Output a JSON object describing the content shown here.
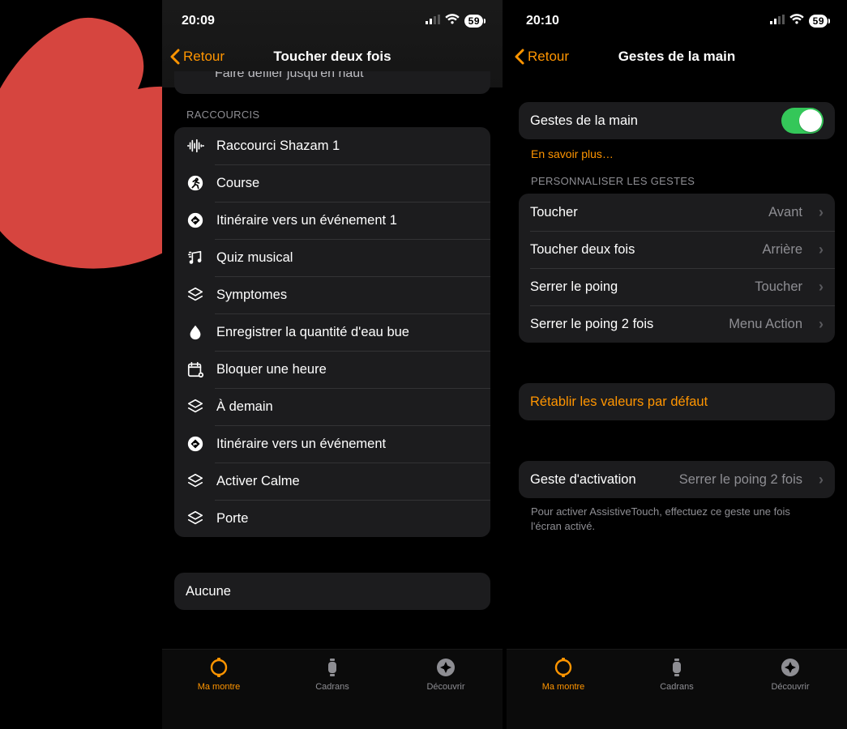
{
  "left": {
    "status": {
      "time": "20:09",
      "battery": "59"
    },
    "nav": {
      "back": "Retour",
      "title": "Toucher deux fois"
    },
    "peek_row": "Faire défiler jusqu'en haut",
    "section_header": "RACCOURCIS",
    "shortcuts": [
      {
        "icon": "waveform-icon",
        "label": "Raccourci Shazam 1"
      },
      {
        "icon": "running-icon",
        "label": "Course"
      },
      {
        "icon": "route-icon",
        "label": "Itinéraire vers un événement 1"
      },
      {
        "icon": "music-note-icon",
        "label": "Quiz musical"
      },
      {
        "icon": "layers-icon",
        "label": "Symptomes"
      },
      {
        "icon": "water-drop-icon",
        "label": "Enregistrer la quantité d'eau bue"
      },
      {
        "icon": "calendar-icon",
        "label": "Bloquer une heure"
      },
      {
        "icon": "layers-icon",
        "label": "À demain"
      },
      {
        "icon": "route-icon",
        "label": "Itinéraire vers un événement"
      },
      {
        "icon": "layers-icon",
        "label": "Activer Calme"
      },
      {
        "icon": "layers-icon",
        "label": "Porte"
      }
    ],
    "none_label": "Aucune"
  },
  "right": {
    "status": {
      "time": "20:10",
      "battery": "59"
    },
    "nav": {
      "back": "Retour",
      "title": "Gestes de la main"
    },
    "toggle_row": {
      "label": "Gestes de la main",
      "on": true
    },
    "learn_more": "En savoir plus…",
    "section_header": "PERSONNALISER LES GESTES",
    "gestures": [
      {
        "label": "Toucher",
        "value": "Avant"
      },
      {
        "label": "Toucher deux fois",
        "value": "Arrière"
      },
      {
        "label": "Serrer le poing",
        "value": "Toucher"
      },
      {
        "label": "Serrer le poing 2 fois",
        "value": "Menu Action"
      }
    ],
    "reset_label": "Rétablir les valeurs par défaut",
    "activation": {
      "label": "Geste d'activation",
      "value": "Serrer le poing 2 fois"
    },
    "activation_note": "Pour activer AssistiveTouch, effectuez ce geste une fois l'écran activé."
  },
  "tabs": [
    {
      "id": "watch",
      "label": "Ma montre",
      "active": true
    },
    {
      "id": "faces",
      "label": "Cadrans",
      "active": false
    },
    {
      "id": "discover",
      "label": "Découvrir",
      "active": false
    }
  ]
}
